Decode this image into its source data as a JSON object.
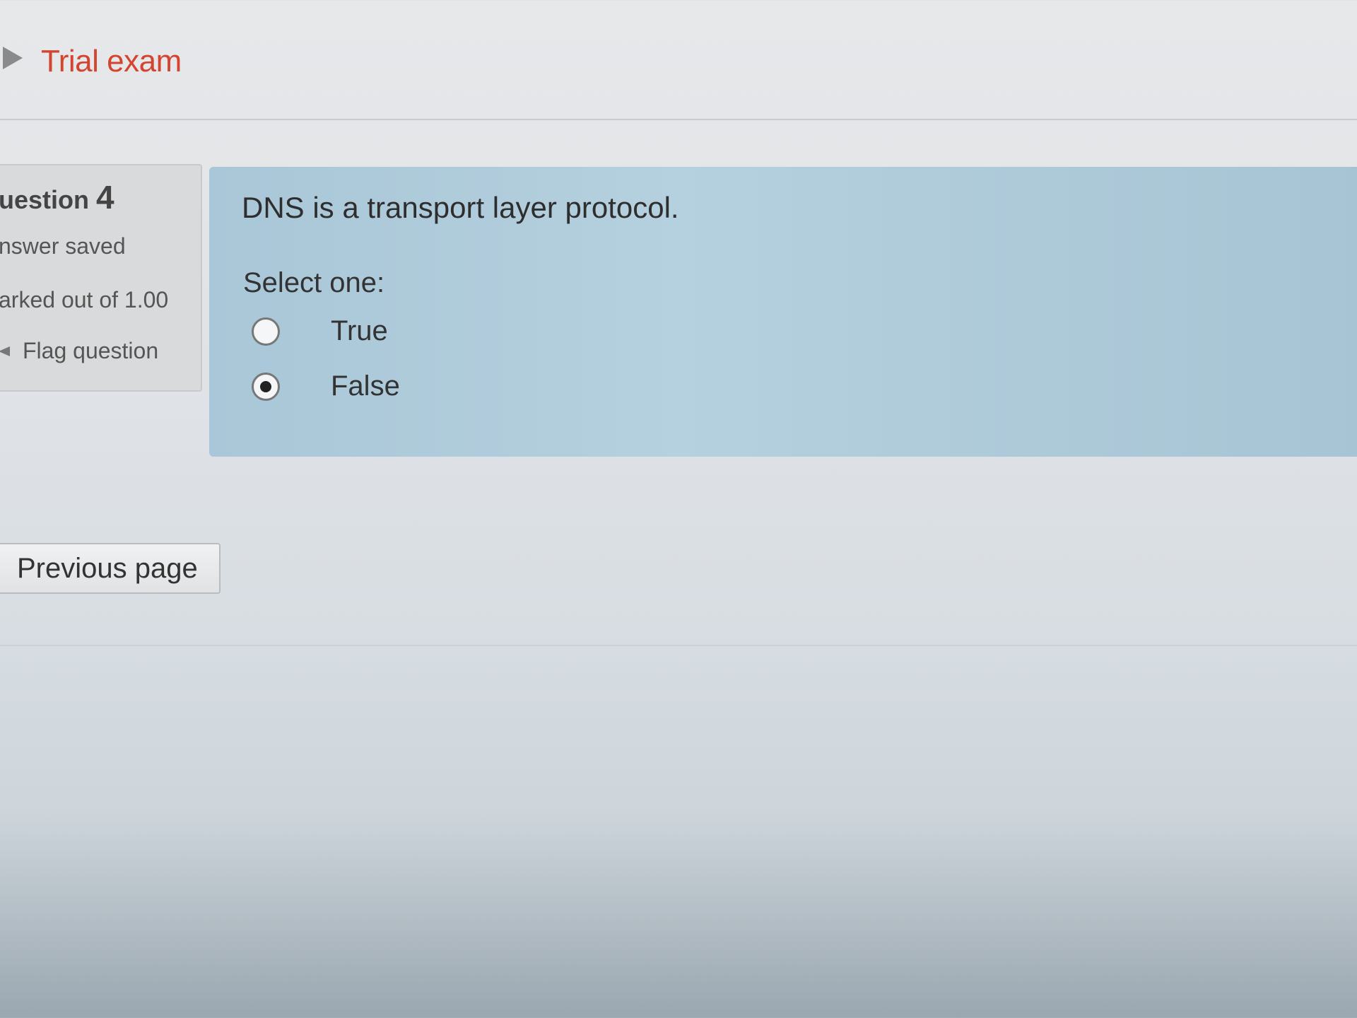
{
  "header": {
    "breadcrumb_icon": "triangle-right-icon",
    "breadcrumb_label": "Trial exam",
    "accent_color": "#d4452f"
  },
  "question_info": {
    "title_prefix": "uestion",
    "number": "4",
    "state": "nswer saved",
    "grade": "arked out of 1.00",
    "flag_icon": "flag-icon",
    "flag_label": "Flag question"
  },
  "question": {
    "text": "DNS is a transport layer protocol.",
    "prompt": "Select one:",
    "options": [
      {
        "label": "True",
        "selected": false
      },
      {
        "label": "False",
        "selected": true
      }
    ],
    "panel_color": "#aecbda"
  },
  "navigation": {
    "previous_label": "Previous page"
  }
}
